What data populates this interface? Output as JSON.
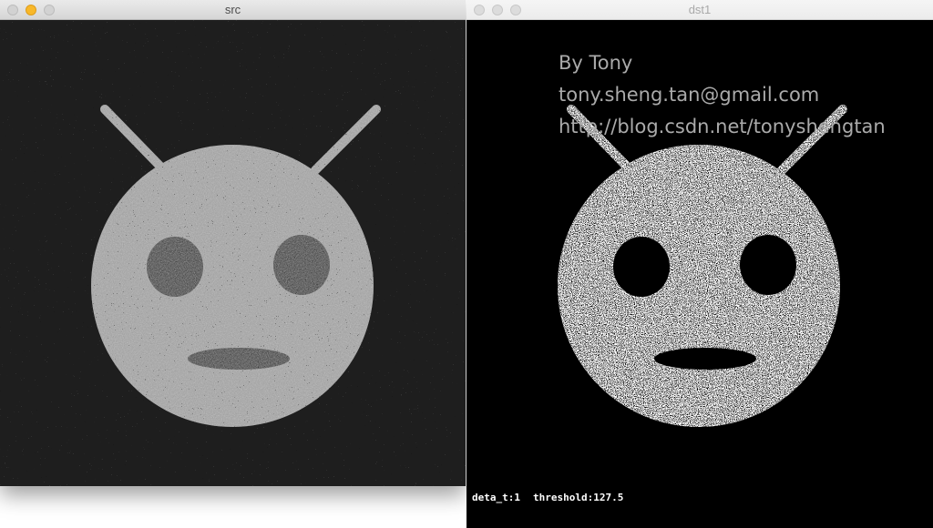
{
  "windows": {
    "src": {
      "title": "src"
    },
    "dst": {
      "title": "dst1",
      "overlay": {
        "line1": "By Tony",
        "line2": "tony.sheng.tan@gmail.com",
        "line3": "http://blog.csdn.net/tonyshengtan"
      },
      "status": {
        "deta": "deta_t:1",
        "threshold": "threshold:127.5"
      }
    }
  },
  "image": {
    "subject": "robot-face",
    "src_colors": {
      "background": "#1e1e1e",
      "face": "#a6a6a6"
    },
    "dst_colors": {
      "background": "#000000",
      "face": "#ffffff"
    }
  }
}
